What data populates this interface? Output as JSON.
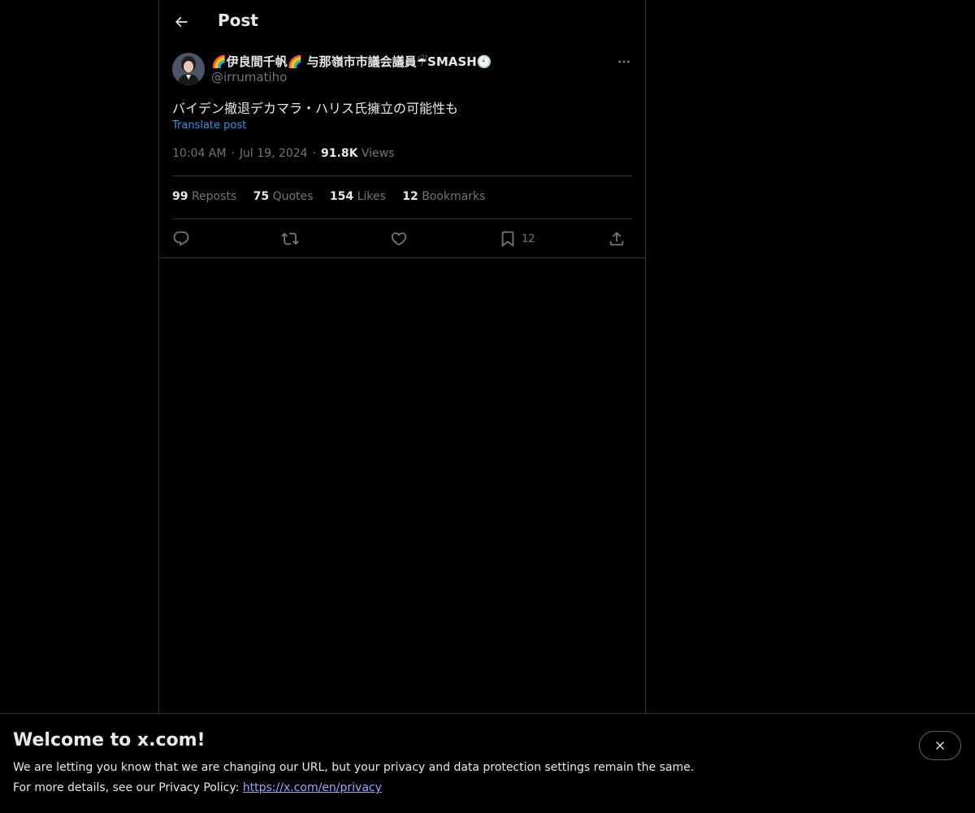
{
  "header": {
    "title": "Post"
  },
  "author": {
    "name": "🌈伊良間千帆🌈 与那嶺市市議会議員☔SMASH🕙",
    "handle": "@irrumatiho"
  },
  "post": {
    "text": "バイデン撤退デカマラ・ハリス氏擁立の可能性も",
    "translate_label": "Translate post",
    "time": "10:04 AM",
    "date": "Jul 19, 2024",
    "views_count": "91.8K",
    "views_label": "Views",
    "separator": "·"
  },
  "stats": [
    {
      "count": "99",
      "label": "Reposts"
    },
    {
      "count": "75",
      "label": "Quotes"
    },
    {
      "count": "154",
      "label": "Likes"
    },
    {
      "count": "12",
      "label": "Bookmarks"
    }
  ],
  "actions": {
    "bookmark_count": "12"
  },
  "icons": {
    "back": "arrow-left-icon",
    "more": "more-horizontal-icon",
    "reply": "reply-icon",
    "repost": "repost-icon",
    "like": "heart-icon",
    "bookmark": "bookmark-icon",
    "share": "share-icon",
    "close": "close-icon"
  },
  "banner": {
    "title": "Welcome to x.com!",
    "line1": "We are letting you know that we are changing our URL, but your privacy and data protection settings remain the same.",
    "line2_prefix": "For more details, see our Privacy Policy: ",
    "link": "https://x.com/en/privacy"
  },
  "colors": {
    "background": "#000000",
    "text": "#e7e9ea",
    "muted": "#71767b",
    "accent": "#1d9bf0",
    "border": "#2f3336"
  }
}
